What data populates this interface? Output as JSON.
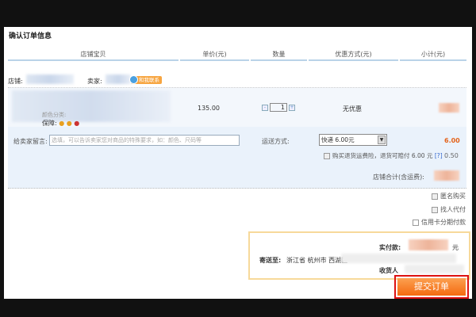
{
  "title": "确认订单信息",
  "columns": [
    "店铺宝贝",
    "单价(元)",
    "数量",
    "优惠方式(元)",
    "小计(元)"
  ],
  "shop": {
    "shop_label": "店铺:",
    "seller_label": "卖家:",
    "contact_label": "和我联系"
  },
  "item": {
    "color_label": "颜色分类:",
    "guarantee_label": "保障:",
    "price": "135.00",
    "quantity": "1",
    "discount": "无优惠",
    "qty_minus": "-",
    "qty_plus": "+"
  },
  "message": {
    "label": "给卖家留言:",
    "placeholder": "选填，可以告诉卖家您对商品的特殊要求，如：颜色、尺码等"
  },
  "shipping": {
    "label": "运送方式:",
    "selected": "快递 6.00元",
    "fee": "6.00",
    "insurance_label": "购买退货运费险，退货可赔付 6.00 元",
    "help": "[?]",
    "insurance_fee": "0.50"
  },
  "shop_total_label": "店铺合计(含运费):",
  "options": [
    "匿名购买",
    "找人代付",
    "信用卡分期付款"
  ],
  "summary": {
    "pay_label": "实付款:",
    "currency": "元",
    "ship_to_label": "寄送至:",
    "address": "浙江省 杭州市 西湖区",
    "receiver_label": "收货人"
  },
  "submit_label": "提交订单",
  "colors": {
    "accent": "#f46a10",
    "fee": "#e4631b",
    "header_line": "#b9d3e8",
    "highlight_border": "#d11111"
  }
}
